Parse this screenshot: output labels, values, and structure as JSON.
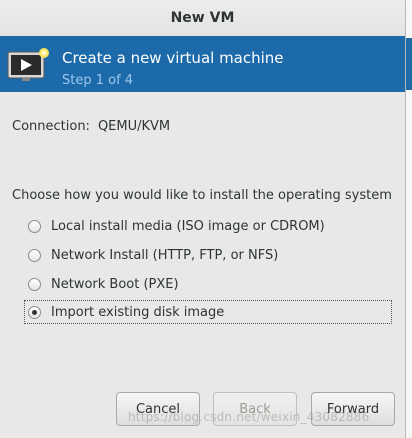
{
  "window": {
    "title": "New VM"
  },
  "banner": {
    "title": "Create a new virtual machine",
    "step": "Step 1 of 4",
    "icon": "monitor-new-vm-icon"
  },
  "connection": {
    "label": "Connection:",
    "value": "QEMU/KVM"
  },
  "install": {
    "prompt": "Choose how you would like to install the operating system",
    "options": [
      {
        "label": "Local install media (ISO image or CDROM)",
        "selected": false
      },
      {
        "label": "Network Install (HTTP, FTP, or NFS)",
        "selected": false
      },
      {
        "label": "Network Boot (PXE)",
        "selected": false
      },
      {
        "label": "Import existing disk image",
        "selected": true
      }
    ]
  },
  "buttons": {
    "cancel": "Cancel",
    "back": "Back",
    "forward": "Forward"
  },
  "watermark": "https://blog.csdn.net/weixin_43082886"
}
